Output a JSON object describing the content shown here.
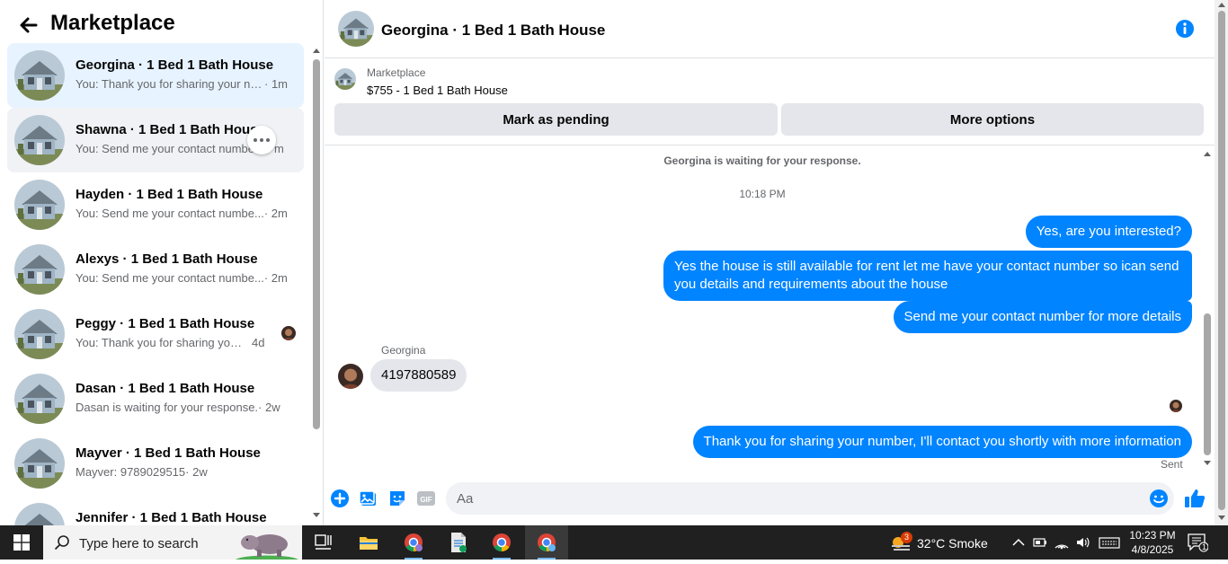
{
  "sidebar": {
    "title": "Marketplace",
    "conversations": [
      {
        "title": "Georgina · 1 Bed 1 Bath House",
        "snippet": "You: Thank you for sharing your nu...",
        "time": "· 1m"
      },
      {
        "title": "Shawna · 1 Bed 1 Bath House",
        "snippet": "You: Send me your contact numbe",
        "time": "m"
      },
      {
        "title": "Hayden · 1 Bed 1 Bath House",
        "snippet": "You: Send me your contact numbe...",
        "time": "· 2m"
      },
      {
        "title": "Alexys · 1 Bed 1 Bath House",
        "snippet": "You: Send me your contact numbe...",
        "time": "· 2m"
      },
      {
        "title": "Peggy · 1 Bed 1 Bath House",
        "snippet": "You: Thank you for sharing your ...",
        "time": "4d"
      },
      {
        "title": "Dasan · 1 Bed 1 Bath House",
        "snippet": "Dasan is waiting for your response.",
        "time": "· 2w"
      },
      {
        "title": "Mayver · 1 Bed 1 Bath House",
        "snippet": "Mayver: 9789029515",
        "time": "· 2w"
      },
      {
        "title": "Jennifer · 1 Bed 1 Bath House",
        "snippet": "",
        "time": ""
      }
    ]
  },
  "chat": {
    "title": "Georgina · 1 Bed 1 Bath House",
    "listing": {
      "label": "Marketplace",
      "price_title": "$755 - 1 Bed 1 Bath House",
      "pending_button": "Mark as pending",
      "more_button": "More options"
    },
    "waiting_notice": "Georgina is waiting for your response.",
    "timestamp": "10:18 PM",
    "messages": {
      "m1": "Yes, are you interested?",
      "m2": "Yes the house is still available for rent let me have your contact number so ican send you details and requirements about the house",
      "m3": "Send me your contact number for more details",
      "sender": "Georgina",
      "m4": "4197880589",
      "m5": "Thank you for sharing your number, I'll contact you shortly with more information"
    },
    "sent_label": "Sent",
    "composer": {
      "placeholder": "Aa"
    },
    "accent": "#0084ff"
  },
  "taskbar": {
    "search_placeholder": "Type here to search",
    "weather": {
      "temp": "32°C  Smoke",
      "badge": "3"
    },
    "clock": {
      "time": "10:23 PM",
      "date": "4/8/2025"
    },
    "notifications": "1"
  }
}
